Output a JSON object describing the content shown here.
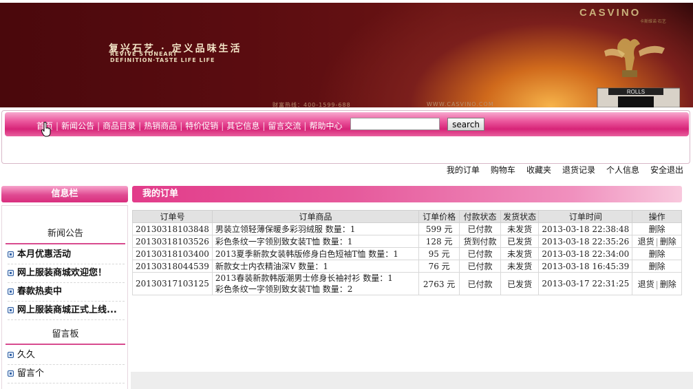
{
  "banner": {
    "slogan": "复兴石艺 · 定义品味生活",
    "sub1": "REVIVE STONEART",
    "sub2": "DEFINITION·TASTE LIFE LIFE",
    "logo": "CASVINO",
    "logo_sub": "卡斯维诺·石艺",
    "phone": "财富热线：400-1599-688",
    "url": "WWW.CASVINO.COM",
    "ornament_text": "ROLLS",
    "colors": {
      "dark": "#4a080c",
      "glow": "#f6b34a",
      "gold": "#c9b07a"
    }
  },
  "nav": {
    "items": [
      "首页",
      "新闻公告",
      "商品目录",
      "热销商品",
      "特价促销",
      "其它信息",
      "留言交流",
      "帮助中心"
    ],
    "search_value": "",
    "search_button": "search",
    "accent": "#d72478"
  },
  "user_links": [
    "我的订单",
    "购物车",
    "收藏夹",
    "退货记录",
    "个人信息",
    "安全退出"
  ],
  "sidebar": {
    "title": "信息栏",
    "news_title": "新闻公告",
    "news": [
      "本月优惠活动",
      "网上服装商城欢迎您！",
      "春款热卖中",
      "网上服装商城正式上线..."
    ],
    "msg_title": "留言板",
    "messages": [
      "久久",
      "留言个"
    ]
  },
  "main": {
    "title": "我的订单",
    "columns": [
      "订单号",
      "订单商品",
      "订单价格",
      "付款状态",
      "发货状态",
      "订单时间",
      "操作"
    ],
    "orders": [
      {
        "id": "20130318103848",
        "goods": [
          "男装立领轻薄保暖多彩羽绒服 数量：1"
        ],
        "price": "599 元",
        "pay": "已付款",
        "ship": "未发货",
        "time": "2013-03-18 22:38:48",
        "ops": [
          "删除"
        ]
      },
      {
        "id": "20130318103526",
        "goods": [
          "彩色条纹一字领别致女装T恤 数量：1"
        ],
        "price": "128 元",
        "pay": "货到付款",
        "ship": "已发货",
        "time": "2013-03-18 22:35:26",
        "ops": [
          "退货",
          "删除"
        ]
      },
      {
        "id": "20130318103400",
        "goods": [
          "2013夏季新款女装韩版修身白色短袖T恤 数量：1"
        ],
        "price": "95 元",
        "pay": "已付款",
        "ship": "未发货",
        "time": "2013-03-18 22:34:00",
        "ops": [
          "删除"
        ]
      },
      {
        "id": "20130318044539",
        "goods": [
          "新款女士内衣精油深V 数量：1"
        ],
        "price": "76 元",
        "pay": "已付款",
        "ship": "未发货",
        "time": "2013-03-18 16:45:39",
        "ops": [
          "删除"
        ]
      },
      {
        "id": "20130317103125",
        "goods": [
          "2013春装新款韩版潮男士修身长袖衬衫 数量：1",
          "彩色条纹一字领别致女装T恤 数量：2"
        ],
        "price": "2763 元",
        "pay": "已付款",
        "ship": "已发货",
        "time": "2013-03-17 22:31:25",
        "ops": [
          "退货",
          "删除"
        ]
      }
    ]
  }
}
